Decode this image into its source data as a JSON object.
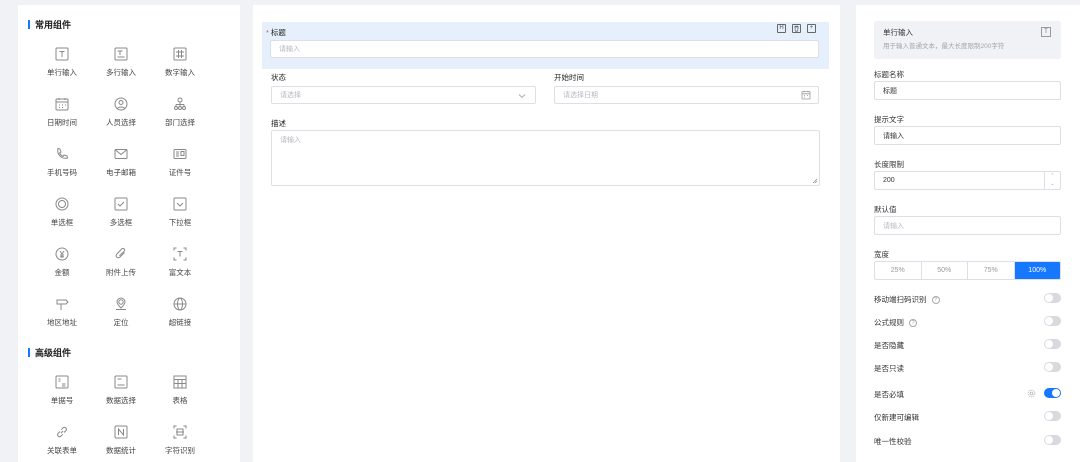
{
  "palette": {
    "common_title": "常用组件",
    "advanced_title": "高级组件",
    "common": [
      {
        "label": "单行输入",
        "icon": "single-line-text-icon"
      },
      {
        "label": "多行输入",
        "icon": "multi-line-text-icon"
      },
      {
        "label": "数字输入",
        "icon": "number-input-icon"
      },
      {
        "label": "日期时间",
        "icon": "calendar-icon"
      },
      {
        "label": "人员选择",
        "icon": "user-icon"
      },
      {
        "label": "部门选择",
        "icon": "org-tree-icon"
      },
      {
        "label": "手机号码",
        "icon": "phone-icon"
      },
      {
        "label": "电子邮箱",
        "icon": "mail-icon"
      },
      {
        "label": "证件号",
        "icon": "id-card-icon"
      },
      {
        "label": "单选框",
        "icon": "radio-icon"
      },
      {
        "label": "多选框",
        "icon": "checkbox-icon"
      },
      {
        "label": "下拉框",
        "icon": "dropdown-icon"
      },
      {
        "label": "金额",
        "icon": "yuan-icon"
      },
      {
        "label": "附件上传",
        "icon": "paperclip-icon"
      },
      {
        "label": "富文本",
        "icon": "rich-text-icon"
      },
      {
        "label": "地区地址",
        "icon": "signpost-icon"
      },
      {
        "label": "定位",
        "icon": "location-icon"
      },
      {
        "label": "超链接",
        "icon": "globe-icon"
      }
    ],
    "advanced": [
      {
        "label": "单据号",
        "icon": "serial-number-icon"
      },
      {
        "label": "数据选择",
        "icon": "data-select-icon"
      },
      {
        "label": "表格",
        "icon": "table-icon"
      },
      {
        "label": "关联表单",
        "icon": "link-icon"
      },
      {
        "label": "数据统计",
        "icon": "statistics-icon"
      },
      {
        "label": "字符识别",
        "icon": "ocr-icon"
      }
    ]
  },
  "canvas": {
    "title_field": {
      "label": "标题",
      "placeholder": "请输入",
      "required": "*"
    },
    "toolbar": {
      "heading": "H",
      "delete": "🗑",
      "copy": "+"
    },
    "status_field": {
      "label": "状态",
      "placeholder": "请选择"
    },
    "start_time_field": {
      "label": "开始时间",
      "placeholder": "请选择日期"
    },
    "description_field": {
      "label": "描述",
      "placeholder": "请输入"
    }
  },
  "props": {
    "header_title": "单行输入",
    "header_desc": "用于输入普通文本，最大长度限制200字符",
    "header_icon": "T",
    "title_name_label": "标题名称",
    "title_name_value": "标题",
    "hint_label": "提示文字",
    "hint_value": "请输入",
    "length_label": "长度限制",
    "length_value": "200",
    "default_label": "默认值",
    "default_placeholder": "请输入",
    "width_label": "宽度",
    "width_options": [
      "25%",
      "50%",
      "75%",
      "100%"
    ],
    "width_selected": "100%",
    "toggles": [
      {
        "label": "移动端扫码识别",
        "help": "?",
        "on": false
      },
      {
        "label": "公式规则",
        "help": "?",
        "on": false
      },
      {
        "label": "是否隐藏",
        "on": false
      },
      {
        "label": "是否只读",
        "on": false
      },
      {
        "label": "是否必填",
        "on": true,
        "gear": true
      },
      {
        "label": "仅新建可编辑",
        "on": false
      },
      {
        "label": "唯一性校验",
        "on": false
      }
    ]
  },
  "colors": {
    "accent": "#1677ff",
    "selected_row": "#e6f0fd",
    "required": "#e34d59"
  }
}
